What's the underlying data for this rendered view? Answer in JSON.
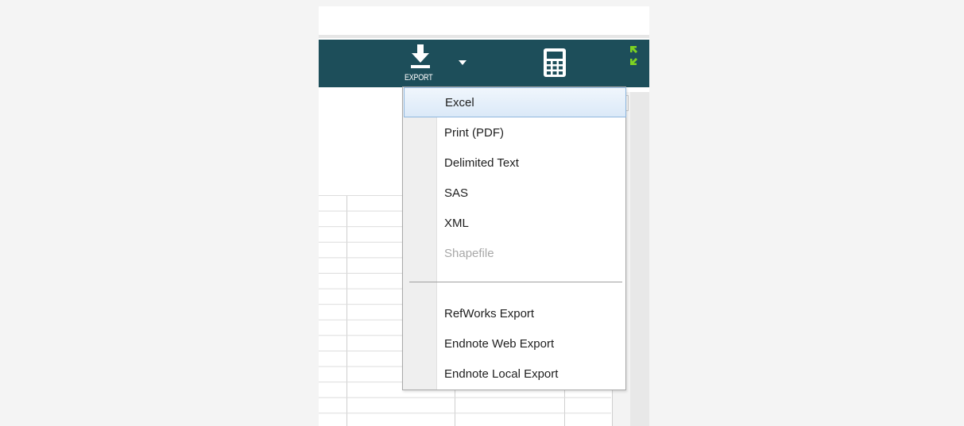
{
  "toolbar": {
    "export_label": "EXPORT",
    "background": "#1d4e5a",
    "icons": [
      "download-icon",
      "caret-down-icon",
      "calculator-icon",
      "expand-icon"
    ],
    "expand_icon_color": "#7ed321"
  },
  "scrollbar": {
    "up_arrow": "▲",
    "grip": "≡"
  },
  "export_menu": {
    "items": [
      {
        "label": "Excel",
        "state": "highlighted"
      },
      {
        "label": "Print (PDF)",
        "state": "normal"
      },
      {
        "label": "Delimited Text",
        "state": "normal"
      },
      {
        "label": "SAS",
        "state": "normal"
      },
      {
        "label": "XML",
        "state": "normal"
      },
      {
        "label": "Shapefile",
        "state": "disabled"
      },
      {
        "label": "RefWorks Export",
        "state": "normal"
      },
      {
        "label": "Endnote Web Export",
        "state": "normal"
      },
      {
        "label": "Endnote Local Export",
        "state": "normal"
      }
    ],
    "highlight_color": "#dbe9f8"
  }
}
